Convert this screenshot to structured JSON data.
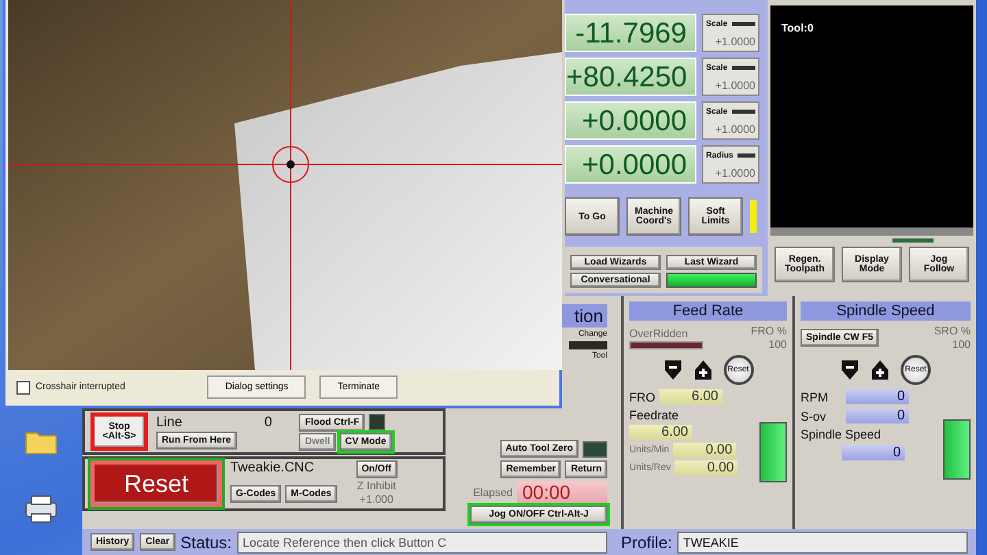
{
  "camera_dialog": {
    "crosshair_interrupted": {
      "label": "Crosshair interrupted",
      "checked": false
    },
    "buttons": [
      "Dialog settings",
      "Terminate"
    ]
  },
  "dro": [
    {
      "value": "-11.7969",
      "scale_label": "Scale",
      "scale": "+1.0000"
    },
    {
      "value": "+80.4250",
      "scale_label": "Scale",
      "scale": "+1.0000"
    },
    {
      "value": "+0.0000",
      "scale_label": "Scale",
      "scale": "+1.0000"
    },
    {
      "value": "+0.0000",
      "scale_label": "Radius",
      "scale": "+1.0000"
    }
  ],
  "dro_buttons": {
    "to_go": "To Go",
    "machine_coords": "Machine Coord's",
    "soft_limits": {
      "label": "Soft Limits",
      "on": true
    }
  },
  "wizards": [
    "Load Wizards",
    "Last Wizard",
    "Conversational"
  ],
  "toolpath": {
    "label": "Tool:0",
    "buttons": [
      "Regen. Toolpath",
      "Display Mode",
      "Jog Follow"
    ]
  },
  "program_run": {
    "stop": "Stop <Alt-S>",
    "line_label": "Line",
    "line_value": "0",
    "run_from_here": "Run From Here",
    "flood": {
      "label": "Flood Ctrl-F",
      "on": false
    },
    "dwell": {
      "label": "Dwell",
      "on": false
    },
    "cv_mode": {
      "label": "CV Mode",
      "on": true
    },
    "reset": "Reset",
    "file": "Tweakie.CNC",
    "on_off": "On/Off",
    "z_inhibit": "Z Inhibit",
    "z_value": "+1.000",
    "gcodes": "G-Codes",
    "mcodes": "M-Codes"
  },
  "tool_panel": {
    "title": "tion",
    "change": "Change",
    "tool": "Tool",
    "auto_tool_zero": "Auto Tool Zero",
    "remember": "Remember",
    "return": "Return",
    "elapsed_label": "Elapsed",
    "elapsed": "00:00",
    "jog": "Jog ON/OFF Ctrl-Alt-J"
  },
  "feed_rate": {
    "title": "Feed Rate",
    "overridden": "OverRidden",
    "percent_label": "FRO %",
    "percent": "100",
    "reset": "Reset",
    "fro_label": "FRO",
    "fro": "6.00",
    "feedrate_label": "Feedrate",
    "feedrate": "6.00",
    "units_min_label": "Units/Min",
    "units_min": "0.00",
    "units_rev_label": "Units/Rev",
    "units_rev": "0.00"
  },
  "spindle": {
    "title": "Spindle Speed",
    "direction_button": "Spindle CW F5",
    "percent_label": "SRO %",
    "percent": "100",
    "reset": "Reset",
    "rpm_label": "RPM",
    "rpm": "0",
    "sov_label": "S-ov",
    "sov": "0",
    "speed_label": "Spindle Speed",
    "speed": "0"
  },
  "status_bar": {
    "history": "History",
    "clear": "Clear",
    "status_label": "Status:",
    "status": "Locate Reference then click Button C",
    "profile_label": "Profile:",
    "profile": "TWEAKIE"
  }
}
